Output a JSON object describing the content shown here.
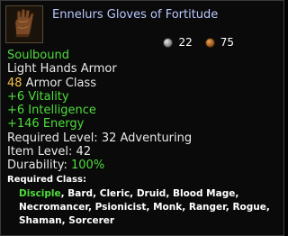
{
  "item": {
    "name": "Ennelurs Gloves of Fortitude",
    "icon": "leather-glove-icon"
  },
  "price": {
    "silver_icon": "silver-coin-icon",
    "silver": "22",
    "copper_icon": "copper-coin-icon",
    "copper": "75"
  },
  "binding": "Soulbound",
  "armor_type": "Light Hands Armor",
  "armor_class": {
    "value": "48",
    "label": " Armor Class"
  },
  "bonuses": [
    "+6 Vitality",
    "+6 Intelligence",
    "+146 Energy"
  ],
  "requirements": {
    "level": "Required Level: 32 Adventuring",
    "item_level": "Item Level: 42",
    "durability_label": "Durability: ",
    "durability_value": "100%"
  },
  "required_class": {
    "label": "Required Class:",
    "classes": [
      {
        "name": "Disciple",
        "sep": ", "
      },
      {
        "name": "Bard",
        "sep": ", "
      },
      {
        "name": "Cleric",
        "sep": ", "
      },
      {
        "name": "Druid",
        "sep": ", "
      },
      {
        "name": "Blood Mage",
        "sep": ", "
      },
      {
        "name": "Necromancer",
        "sep": ", "
      },
      {
        "name": "Psionicist",
        "sep": ", "
      },
      {
        "name": "Monk",
        "sep": ", "
      },
      {
        "name": "Ranger",
        "sep": ", "
      },
      {
        "name": "Rogue",
        "sep": ", "
      },
      {
        "name": "Shaman",
        "sep": ", "
      },
      {
        "name": "Sorcerer",
        "sep": ""
      }
    ]
  },
  "colors": {
    "title": "#b9c8ff",
    "positive": "#4fdc3c",
    "armor_class_value": "#f3c24a",
    "text": "#e8e8e8",
    "background": "#0a0a0a"
  }
}
